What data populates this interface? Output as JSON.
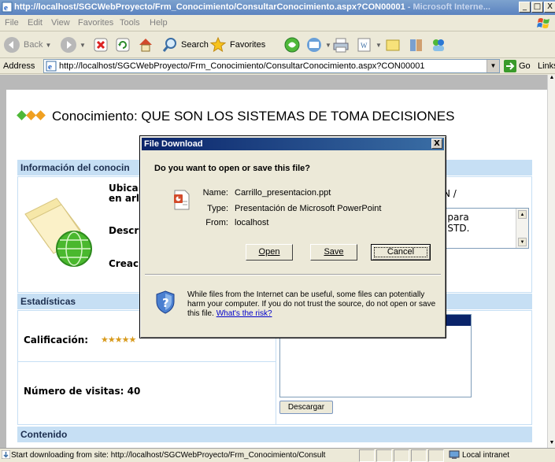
{
  "window": {
    "title": "http://localhost/SGCWebProyecto/Frm_Conocimiento/ConsultarConocimiento.aspx?CON00001",
    "title_suffix": " - Microsoft Interne...",
    "min": "_",
    "max": "□",
    "close": "X"
  },
  "menu": [
    "File",
    "Edit",
    "View",
    "Favorites",
    "Tools",
    "Help"
  ],
  "toolbar": {
    "back": "Back",
    "search": "Search",
    "favorites": "Favorites"
  },
  "address": {
    "label": "Address",
    "url": "http://localhost/SGCWebProyecto/Frm_Conocimiento/ConsultarConocimiento.aspx?CON00001",
    "go": "Go",
    "links": "Links"
  },
  "page": {
    "heading": "Conocimiento: QUE SON LOS SISTEMAS DE TOMA DECISIONES",
    "sections": {
      "info": "Información del conocin",
      "stats": "Estadísticas",
      "content": "Contenido"
    },
    "labels": {
      "ubic": "Ubica",
      "enar": "en arl",
      "descr": "Descr",
      "creac": "Creac",
      "ion": "IÓN /",
      "desc_line1": "as para",
      "desc_line2": "os STD."
    },
    "calificacion_label": "Calificación:",
    "rating_stars": "★★★★★",
    "visitas_label": "Número de visitas: 40",
    "descargar": "Descargar"
  },
  "dialog": {
    "title": "File Download",
    "close": "X",
    "question": "Do you want to open or save this file?",
    "name_label": "Name:",
    "name_value": "Carrillo_presentacion.ppt",
    "type_label": "Type:",
    "type_value": "Presentación de Microsoft PowerPoint",
    "from_label": "From:",
    "from_value": "localhost",
    "open": "Open",
    "save": "Save",
    "cancel": "Cancel",
    "warning": "While files from the Internet can be useful, some files can potentially harm your computer. If you do not trust the source, do not open or save this file.",
    "risk_link": "What's the risk?"
  },
  "status": {
    "text": "Start downloading from site: http://localhost/SGCWebProyecto/Frm_Conocimiento/Consult",
    "zone": "Local intranet"
  },
  "colors": {
    "section_bg": "#c6dff4",
    "dialog_title": "#0a246a",
    "diamond_green": "#4fb838",
    "diamond_orange": "#f0a020",
    "star_gold": "#d89a1c"
  }
}
